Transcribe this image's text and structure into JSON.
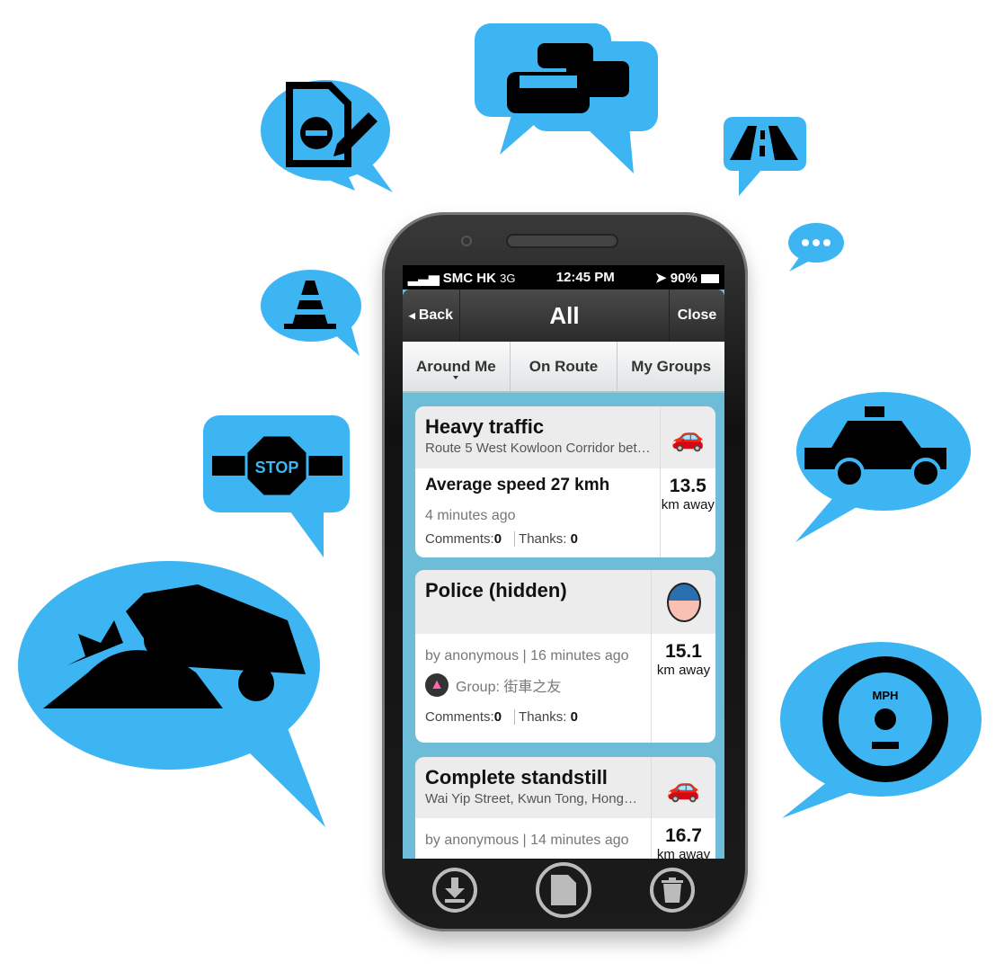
{
  "status_bar": {
    "carrier": "SMC HK",
    "network": "3G",
    "time": "12:45 PM",
    "battery": "90%"
  },
  "nav": {
    "back": "Back",
    "title": "All",
    "close": "Close"
  },
  "tabs": [
    {
      "label": "Around Me",
      "selected": true
    },
    {
      "label": "On Route"
    },
    {
      "label": "My Groups"
    }
  ],
  "reports": [
    {
      "title": "Heavy traffic",
      "subtitle": "Route 5 West Kowloon Corridor bet…",
      "headline": "Average speed 27 kmh",
      "time": "4 minutes ago",
      "comments_label": "Comments:",
      "comments": "0",
      "thanks_label": "Thanks:",
      "thanks": "0",
      "distance": "13.5",
      "unit": "km away",
      "icon": "traffic-jam-icon"
    },
    {
      "title": "Police (hidden)",
      "meta": "by anonymous | 16 minutes ago",
      "group": "Group: 街車之友",
      "comments_label": "Comments:",
      "comments": "0",
      "thanks_label": "Thanks:",
      "thanks": "0",
      "distance": "15.1",
      "unit": "km away",
      "icon": "police-icon"
    },
    {
      "title": "Complete standstill",
      "subtitle": "Wai Yip Street, Kwun Tong, Hong…",
      "meta": "by anonymous | 14 minutes ago",
      "distance": "16.7",
      "unit": "km away",
      "icon": "traffic-jam-icon"
    }
  ],
  "bubble_stop_text": "STOP",
  "bubble_mph_text": "MPH",
  "colors": {
    "bubble": "#3db5f2",
    "list_bg": "#6dbdd9"
  }
}
